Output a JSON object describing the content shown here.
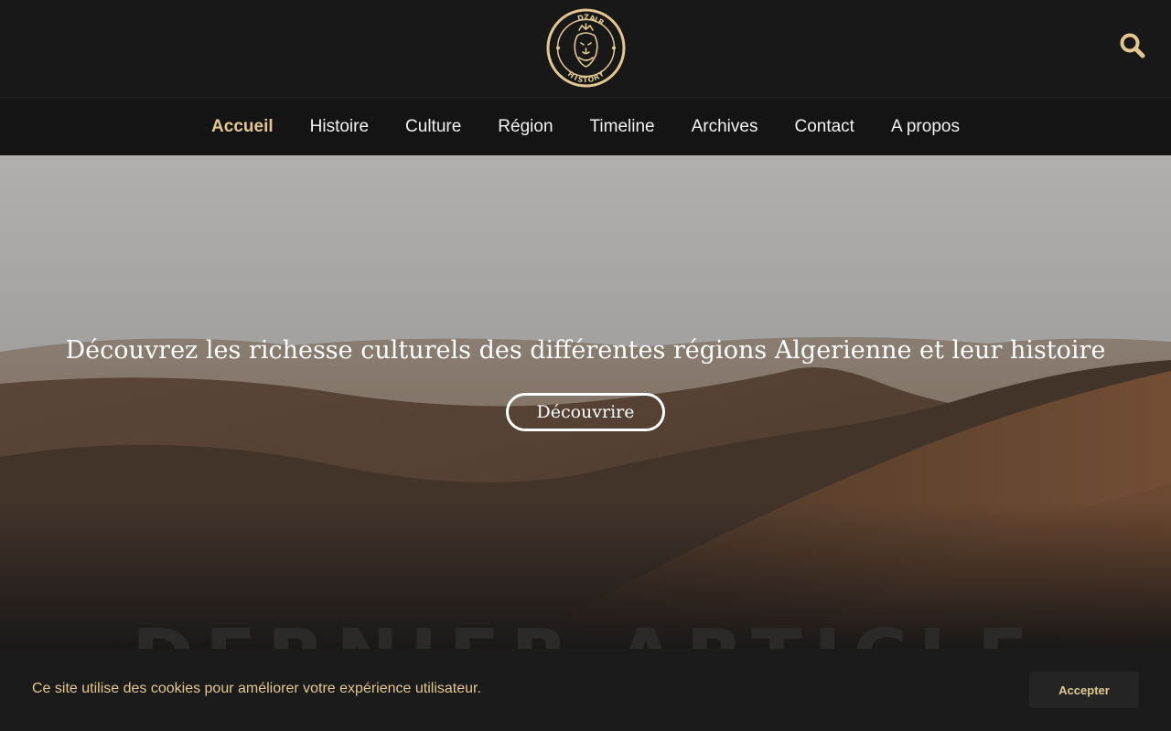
{
  "header": {
    "logo_icon": "lion-crest-logo-icon",
    "search_icon": "search-icon"
  },
  "nav": {
    "items": [
      {
        "label": "Accueil",
        "active": true
      },
      {
        "label": "Histoire",
        "active": false
      },
      {
        "label": "Culture",
        "active": false
      },
      {
        "label": "Région",
        "active": false
      },
      {
        "label": "Timeline",
        "active": false
      },
      {
        "label": "Archives",
        "active": false
      },
      {
        "label": "Contact",
        "active": false
      },
      {
        "label": "A propos",
        "active": false
      }
    ]
  },
  "hero": {
    "title": "Découvrez les richesse culturels des différentes régions Algerienne et leur histoire",
    "button_label": "Découvrire"
  },
  "section": {
    "heading": "DERNIER ARTICLE"
  },
  "cookie": {
    "message": "Ce site utilise des cookies pour améliorer votre expérience utilisateur.",
    "accept_label": "Accepter"
  },
  "colors": {
    "accent": "#e2c793",
    "header_bg": "#181818",
    "nav_bg": "#141414",
    "cookie_bg": "#1b1b1b"
  }
}
